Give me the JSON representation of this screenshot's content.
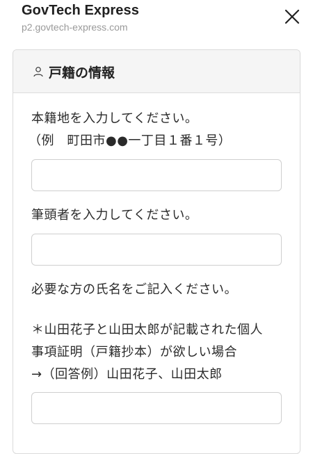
{
  "header": {
    "site_title": "GovTech Express",
    "site_url": "p2.govtech-express.com",
    "close_icon": "close-icon"
  },
  "card": {
    "icon": "person-icon",
    "title": "戸籍の情報",
    "fields": [
      {
        "label_lines": [
          "本籍地を入力してください。",
          "（例　町田市●●一丁目１番１号）"
        ],
        "value": "",
        "placeholder": ""
      },
      {
        "label_lines": [
          "筆頭者を入力してください。"
        ],
        "value": "",
        "placeholder": ""
      },
      {
        "label_lines": [
          "必要な方の氏名をご記入ください。",
          "",
          "＊山田花子と山田太郎が記載された個人",
          "事項証明（戸籍抄本）が欲しい場合",
          "→（回答例）山田花子、山田太郎"
        ],
        "value": "",
        "placeholder": ""
      }
    ]
  }
}
